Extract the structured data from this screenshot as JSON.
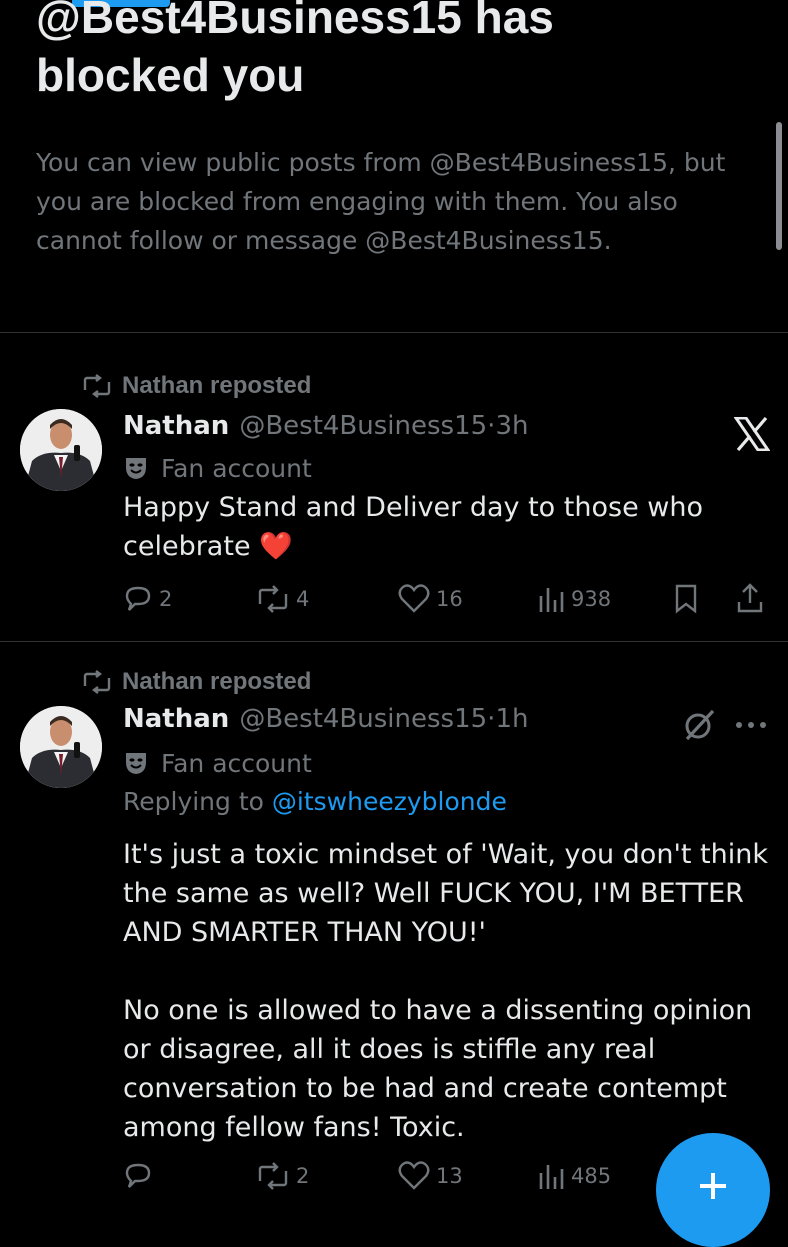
{
  "blocked": {
    "title": "@Best4Business15 has blocked you",
    "description": "You can view public posts from @Best4Business15, but you are blocked from engaging with them. You also cannot follow or message @Best4Business15."
  },
  "posts": [
    {
      "repost_label": "Nathan reposted",
      "name": "Nathan",
      "handle": "@Best4Business15",
      "separator": "·",
      "time": "3h",
      "label": "Fan account",
      "text": "Happy Stand and Deliver day to those who celebrate ❤️",
      "replies": "2",
      "reposts": "4",
      "likes": "16",
      "views": "938",
      "corner_icon": "x-logo-icon"
    },
    {
      "repost_label": "Nathan reposted",
      "name": "Nathan",
      "handle": "@Best4Business15",
      "separator": "·",
      "time": "1h",
      "label": "Fan account",
      "replying_prefix": "Replying to",
      "replying_to": "@itswheezyblonde",
      "text": "It's just a toxic mindset of 'Wait, you don't think the same as well? Well FUCK YOU, I'M BETTER AND SMARTER THAN YOU!'\n\nNo one is allowed to have a dissenting opinion or disagree, all it does is stiffle any real conversation to be had and create contempt among fellow fans! Toxic.",
      "replies": "",
      "reposts": "2",
      "likes": "13",
      "views": "485",
      "corner_icon": "grok-icon"
    }
  ],
  "colors": {
    "background": "#000000",
    "primary_text": "#e7e9ea",
    "secondary_text": "#71767b",
    "accent": "#1d9bf0",
    "divider": "#2f3336",
    "heart": "#e0245e"
  }
}
